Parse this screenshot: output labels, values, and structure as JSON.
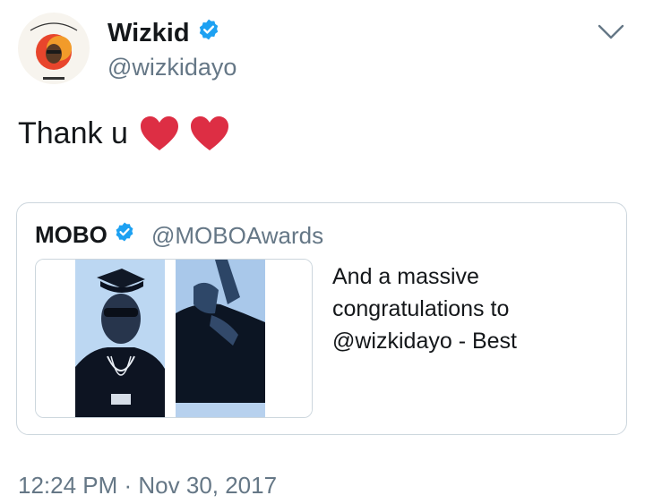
{
  "author": {
    "display_name": "Wizkid",
    "handle": "@wizkidayo",
    "verified": true
  },
  "tweet": {
    "text": "Thank u",
    "emoji": [
      "red-heart",
      "red-heart"
    ]
  },
  "quoted_tweet": {
    "display_name": "MOBO",
    "handle": "@MOBOAwards",
    "verified": true,
    "text": "And a massive congratulations to @wizkidayo - Best"
  },
  "meta": {
    "timestamp": "12:24 PM · Nov 30, 2017"
  },
  "colors": {
    "verified_blue": "#1da1f2",
    "heart_red": "#dd2e44",
    "secondary_text": "#657786",
    "border": "#ccd6dd"
  }
}
